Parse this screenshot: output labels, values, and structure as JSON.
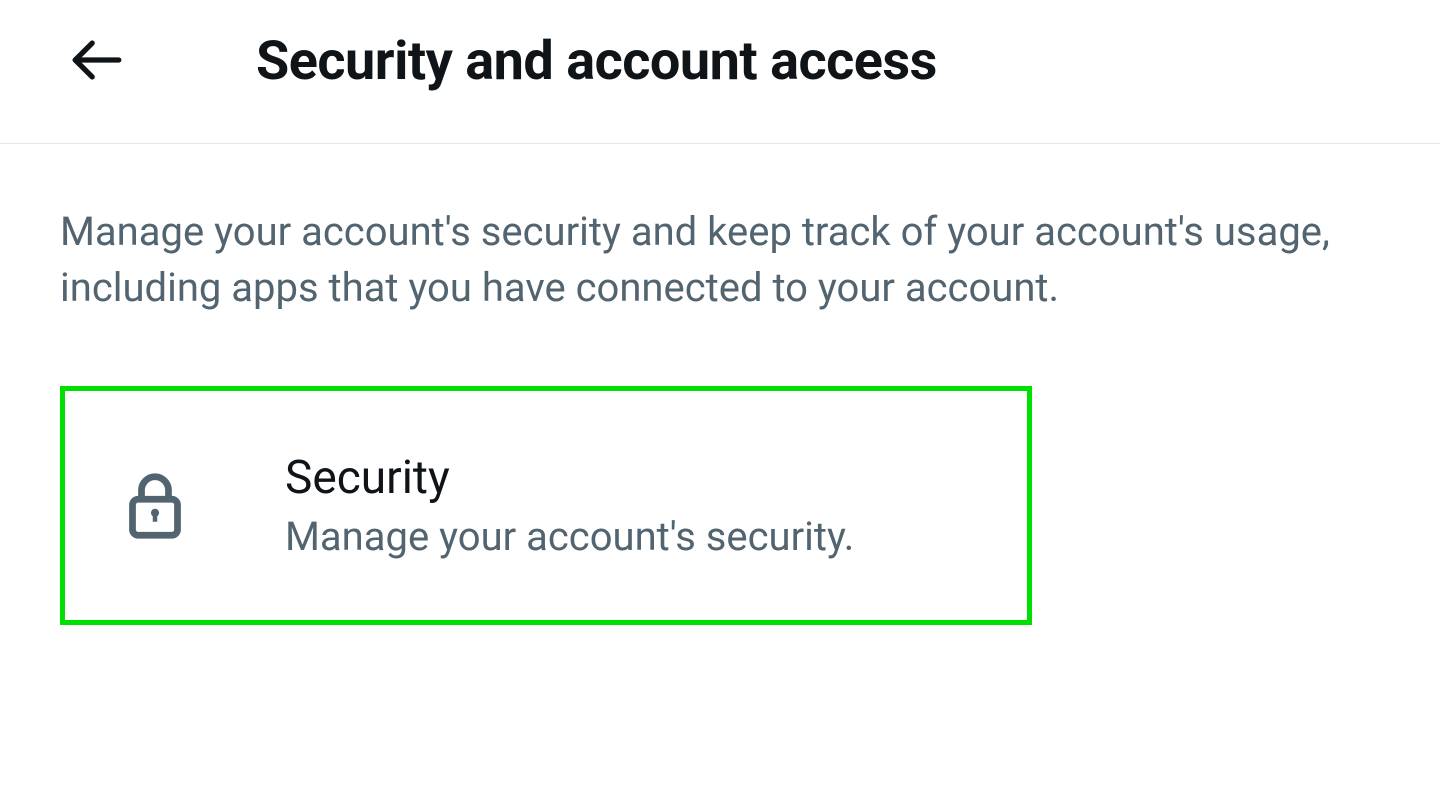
{
  "header": {
    "title": "Security and account access"
  },
  "content": {
    "description": "Manage your account's security and keep track of your account's usage, including apps that you have connected to your account."
  },
  "options": [
    {
      "title": "Security",
      "subtitle": "Manage your account's security."
    }
  ]
}
